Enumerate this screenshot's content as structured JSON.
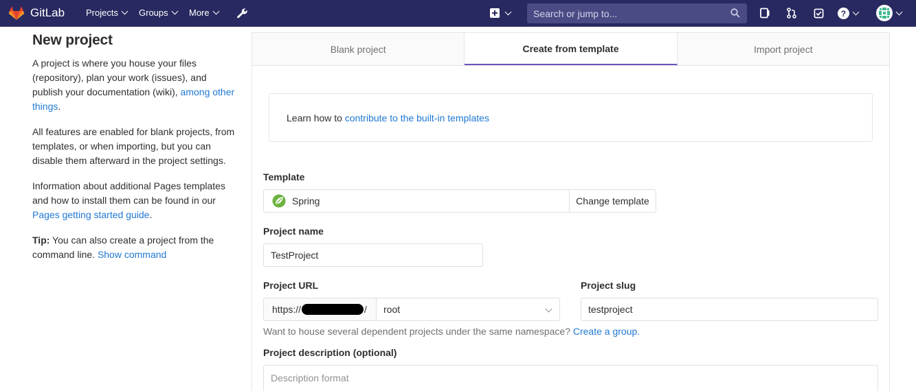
{
  "navbar": {
    "brand": "GitLab",
    "projects": "Projects",
    "groups": "Groups",
    "more": "More",
    "search_placeholder": "Search or jump to..."
  },
  "left": {
    "title": "New project",
    "p1_text": "A project is where you house your files (repository), plan your work (issues), and publish your documentation (wiki),",
    "p1_link": "among other things",
    "p1_end": ".",
    "p2": "All features are enabled for blank projects, from templates, or when importing, but you can disable them afterward in the project settings.",
    "p3_text": "Information about additional Pages templates and how to install them can be found in our",
    "p3_link": "Pages getting started guide",
    "p3_end": ".",
    "tip_label": "Tip:",
    "tip_text": "You can also create a project from the command line.",
    "tip_link": "Show command"
  },
  "tabs": {
    "blank": "Blank project",
    "template": "Create from template",
    "import": "Import project"
  },
  "info": {
    "text": "Learn how to",
    "link": "contribute to the built-in templates"
  },
  "form": {
    "template_label": "Template",
    "template_value": "Spring",
    "change_template": "Change template",
    "name_label": "Project name",
    "name_value": "TestProject",
    "url_label": "Project URL",
    "url_prefix_start": "https://",
    "url_prefix_end": "/",
    "namespace": "root",
    "slug_label": "Project slug",
    "slug_value": "testproject",
    "help_text": "Want to house several dependent projects under the same namespace?",
    "help_link": "Create a group.",
    "desc_label": "Project description (optional)",
    "desc_placeholder": "Description format"
  }
}
